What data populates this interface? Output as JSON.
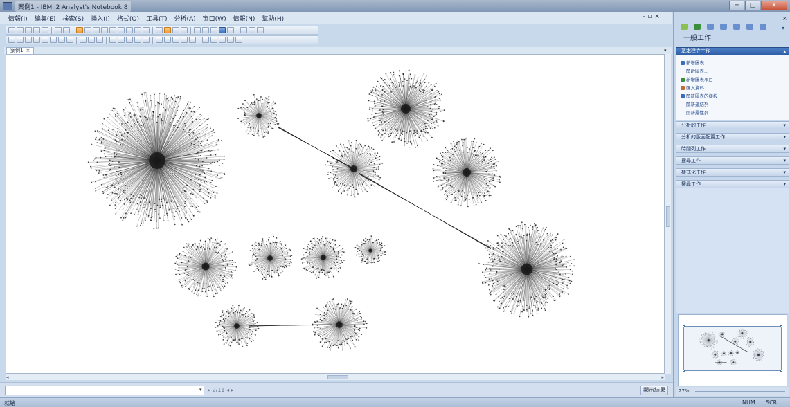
{
  "window": {
    "title": "案例1 - IBM i2 Analyst's Notebook 8",
    "buttons": {
      "minimize": "─",
      "maximize": "□",
      "close": "✕"
    }
  },
  "menu": [
    "情報(I)",
    "編集(E)",
    "検索(S)",
    "挿入(I)",
    "格式(O)",
    "工具(T)",
    "分析(A)",
    "窗口(W)",
    "情報(N)",
    "幫助(H)"
  ],
  "mdi_controls": [
    "-",
    "▫",
    "×"
  ],
  "document": {
    "tab_label": "案例1",
    "tab_close": "×"
  },
  "bottom": {
    "search_value": "",
    "small_labels": "▸ 2/11 ◂ ▸",
    "result_button": "顯示結果"
  },
  "status": {
    "left": "就緒",
    "right1": "NUM",
    "right2": "SCRL"
  },
  "task_pane": {
    "title": "一般工作",
    "close": "×",
    "pin": "▾",
    "sections": [
      {
        "label": "基本建立工作",
        "active": true,
        "chevron": "▴"
      },
      {
        "label": "分析的工作",
        "active": false,
        "chevron": "▾"
      },
      {
        "label": "分析的版面配置工作",
        "active": false,
        "chevron": "▾"
      },
      {
        "label": "時間列工作",
        "active": false,
        "chevron": "▾"
      },
      {
        "label": "搜尋工作",
        "active": false,
        "chevron": "▾"
      },
      {
        "label": "樣式化工作",
        "active": false,
        "chevron": "▾"
      },
      {
        "label": "搜尋工作",
        "active": false,
        "chevron": "▾"
      }
    ],
    "tasks": [
      {
        "label": "新增圖表",
        "icon_color": "#3b6bbf"
      },
      {
        "label": "開啟圖表...",
        "icon_color": ""
      },
      {
        "label": "新增圖表項目",
        "icon_color": "#3b8f3b"
      },
      {
        "label": "匯入資料",
        "icon_color": "#c66b2c"
      },
      {
        "label": "開新圖表的樣板",
        "icon_color": "#3b6bbf"
      },
      {
        "label": "開新連結列",
        "icon_color": ""
      },
      {
        "label": "開新屬性列",
        "icon_color": ""
      }
    ]
  },
  "zoom": {
    "label": "27%"
  },
  "colors": {
    "accent": "#2e5ea6",
    "panel": "#c6d7ec",
    "canvas": "#ffffff",
    "node": "#1a1a1a"
  }
}
